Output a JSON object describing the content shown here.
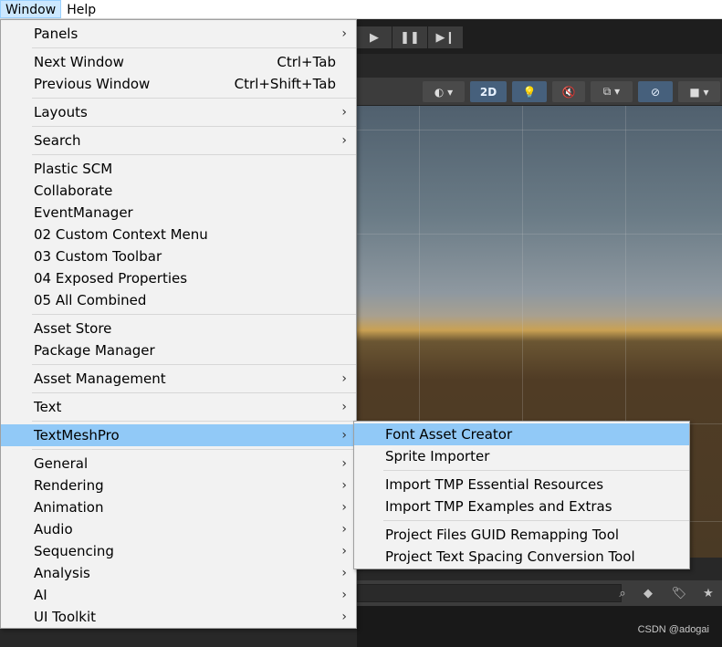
{
  "menubar": {
    "items": [
      {
        "label": "Window",
        "active": true
      },
      {
        "label": "Help",
        "active": false
      }
    ]
  },
  "unity": {
    "scene_toolbar": {
      "mode_2d_label": "2D"
    }
  },
  "main_menu": {
    "groups": [
      [
        {
          "label": "Panels",
          "submenu": true
        }
      ],
      [
        {
          "label": "Next Window",
          "shortcut": "Ctrl+Tab"
        },
        {
          "label": "Previous Window",
          "shortcut": "Ctrl+Shift+Tab"
        }
      ],
      [
        {
          "label": "Layouts",
          "submenu": true
        }
      ],
      [
        {
          "label": "Search",
          "submenu": true
        }
      ],
      [
        {
          "label": "Plastic SCM"
        },
        {
          "label": "Collaborate"
        },
        {
          "label": "EventManager"
        },
        {
          "label": "02 Custom Context Menu"
        },
        {
          "label": "03 Custom Toolbar"
        },
        {
          "label": "04 Exposed Properties"
        },
        {
          "label": "05 All Combined"
        }
      ],
      [
        {
          "label": "Asset Store"
        },
        {
          "label": "Package Manager"
        }
      ],
      [
        {
          "label": "Asset Management",
          "submenu": true
        }
      ],
      [
        {
          "label": "Text",
          "submenu": true
        }
      ],
      [
        {
          "label": "TextMeshPro",
          "submenu": true,
          "highlighted": true
        }
      ],
      [
        {
          "label": "General",
          "submenu": true
        },
        {
          "label": "Rendering",
          "submenu": true
        },
        {
          "label": "Animation",
          "submenu": true
        },
        {
          "label": "Audio",
          "submenu": true
        },
        {
          "label": "Sequencing",
          "submenu": true
        },
        {
          "label": "Analysis",
          "submenu": true
        },
        {
          "label": "AI",
          "submenu": true
        },
        {
          "label": "UI Toolkit",
          "submenu": true
        }
      ]
    ]
  },
  "sub_menu": {
    "groups": [
      [
        {
          "label": "Font Asset Creator",
          "highlighted": true
        },
        {
          "label": "Sprite Importer"
        }
      ],
      [
        {
          "label": "Import TMP Essential Resources"
        },
        {
          "label": "Import TMP Examples and Extras"
        }
      ],
      [
        {
          "label": "Project Files GUID Remapping Tool"
        },
        {
          "label": "Project Text Spacing Conversion Tool"
        }
      ]
    ]
  },
  "watermark": "CSDN @adogai",
  "submenu_arrow": "›",
  "colors": {
    "highlight": "#91c9f7",
    "menu_bg": "#f2f2f2",
    "active_menubar": "#cce8ff"
  }
}
